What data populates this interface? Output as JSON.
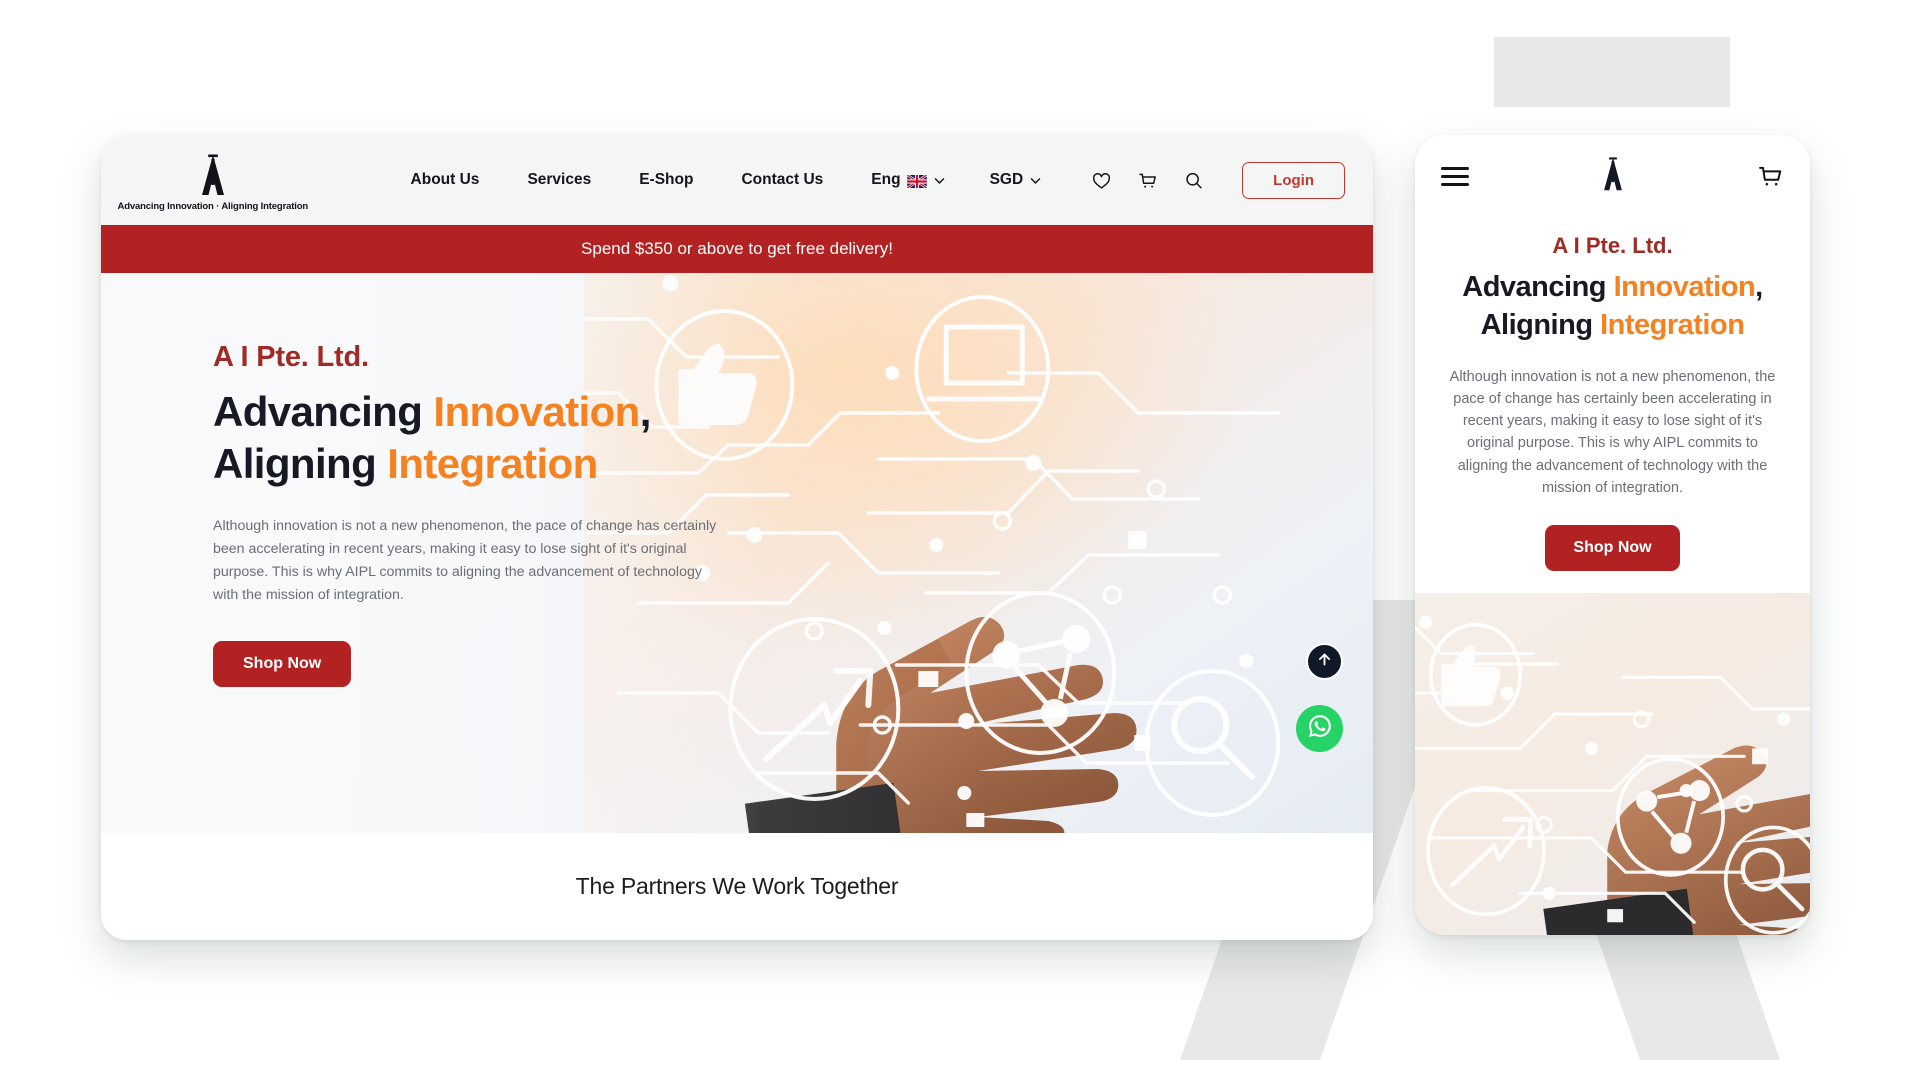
{
  "brand": {
    "logo_icon": "ai-monogram-logo",
    "tagline": "Advancing Innovation · Aligning Integration",
    "accent_red": "#b22222",
    "accent_orange": "#f58220",
    "kicker_red": "#9e2b25",
    "ink": "#171a24"
  },
  "desktop": {
    "nav": [
      {
        "label": "About Us",
        "name": "nav-about-us"
      },
      {
        "label": "Services",
        "name": "nav-services"
      },
      {
        "label": "E-Shop",
        "name": "nav-eshop"
      },
      {
        "label": "Contact Us",
        "name": "nav-contact-us"
      }
    ],
    "language": {
      "label": "Eng",
      "flag": "uk-flag-icon",
      "chevron": "chevron-down-icon"
    },
    "currency": {
      "label": "SGD",
      "chevron": "chevron-down-icon"
    },
    "icons": [
      {
        "name": "wishlist-heart-icon"
      },
      {
        "name": "cart-icon"
      },
      {
        "name": "search-icon"
      }
    ],
    "login_label": "Login",
    "promo_text": "Spend $350 or above to get free delivery!",
    "hero": {
      "kicker": "A I Pte. Ltd.",
      "headline_line1_dark": "Advancing ",
      "headline_line1_accent": "Innovation",
      "headline_line1_tail": ",",
      "headline_line2_dark": "Aligning ",
      "headline_line2_accent": "Integration",
      "paragraph": "Although innovation is not a new phenomenon, the pace of change has certainly been accelerating in recent years, making it easy to lose sight of it's original purpose. This is why AIPL commits to aligning the advancement of technology with the mission of integration.",
      "cta_label": "Shop Now",
      "image_alt": "hand touching circuit-board technology overlay"
    },
    "floating": {
      "scroll_top": "scroll-to-top-icon",
      "whatsapp": "whatsapp-icon"
    },
    "partners_title": "The Partners We Work Together"
  },
  "mobile": {
    "menu_icon": "hamburger-menu-icon",
    "logo_icon": "ai-monogram-logo",
    "cart_icon": "cart-icon",
    "hero": {
      "kicker": "A I Pte. Ltd.",
      "headline_line1_dark": "Advancing ",
      "headline_line1_accent": "Innovation",
      "headline_line1_tail": ",",
      "headline_line2_dark": "Aligning ",
      "headline_line2_accent": "Integration",
      "paragraph": "Although innovation is not a new phenomenon, the pace of change has certainly been accelerating in recent years, making it easy to lose sight of it's original purpose. This is why AIPL commits to aligning the advancement of technology with the mission of integration.",
      "cta_label": "Shop Now",
      "image_alt": "hand touching circuit-board technology overlay"
    }
  }
}
